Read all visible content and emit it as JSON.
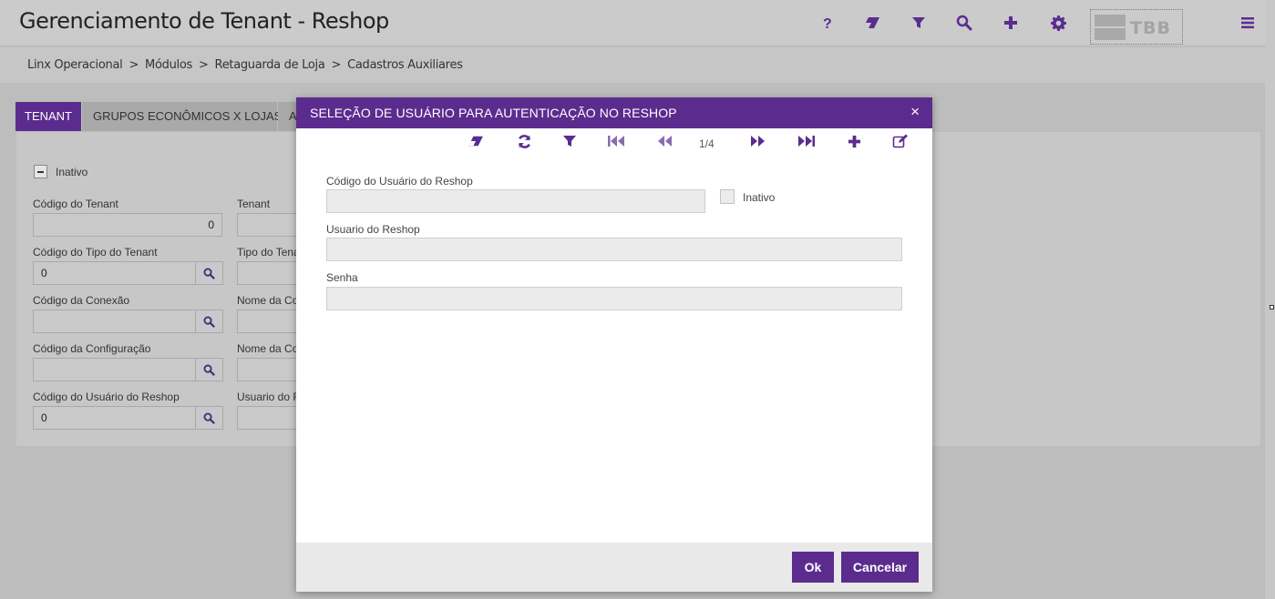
{
  "header": {
    "title": "Gerenciamento de Tenant - Reshop",
    "icons": [
      "help-icon",
      "eraser-icon",
      "filter-icon",
      "search-icon",
      "plus-icon",
      "gear-icon",
      "menu-icon"
    ],
    "logo_text": "TBB"
  },
  "breadcrumb": {
    "items": [
      "Linx Operacional",
      "Módulos",
      "Retaguarda de Loja",
      "Cadastros Auxiliares"
    ],
    "separator": ">"
  },
  "tabs": [
    {
      "label": "TENANT"
    },
    {
      "label": "GRUPOS ECONÔMICOS X LOJAS"
    },
    {
      "label": "A"
    }
  ],
  "form": {
    "inativo_label": "Inativo",
    "codigo_tenant_label": "Código do Tenant",
    "codigo_tenant_value": "0",
    "tenant_label": "Tenant",
    "codigo_tipo_tenant_label": "Código do Tipo do Tenant",
    "codigo_tipo_tenant_value": "0",
    "tipo_tenant_label": "Tipo do Tena",
    "codigo_conexao_label": "Código da Conexão",
    "codigo_conexao_value": "",
    "nome_conexao_label": "Nome da Co",
    "codigo_configuracao_label": "Código da Configuração",
    "codigo_configuracao_value": "",
    "nome_configuracao_label": "Nome da Co",
    "codigo_usuario_reshop_label": "Código do Usuário do Reshop",
    "codigo_usuario_reshop_value": "0",
    "usuario_reshop_label": "Usuario do R"
  },
  "modal": {
    "title": "SELEÇÃO DE USUÁRIO PARA AUTENTICAÇÃO NO RESHOP",
    "close_glyph": "×",
    "toolbar_icons": [
      "eraser-icon",
      "refresh-icon",
      "filter-icon",
      "first-page-icon",
      "prev-page-icon",
      "next-page-icon",
      "last-page-icon",
      "plus-icon",
      "edit-icon"
    ],
    "pager": "1/4",
    "codigo_usuario_label": "Código do Usuário do Reshop",
    "codigo_usuario_value": "",
    "inativo_label": "Inativo",
    "inativo_checked": false,
    "usuario_label": "Usuario do Reshop",
    "usuario_value": "",
    "senha_label": "Senha",
    "senha_value": "",
    "ok_label": "Ok",
    "cancel_label": "Cancelar"
  },
  "colors": {
    "accent": "#5b2c8e",
    "overlay_gray": "#c6c6c6",
    "footer_bg": "#e9e9e9"
  }
}
